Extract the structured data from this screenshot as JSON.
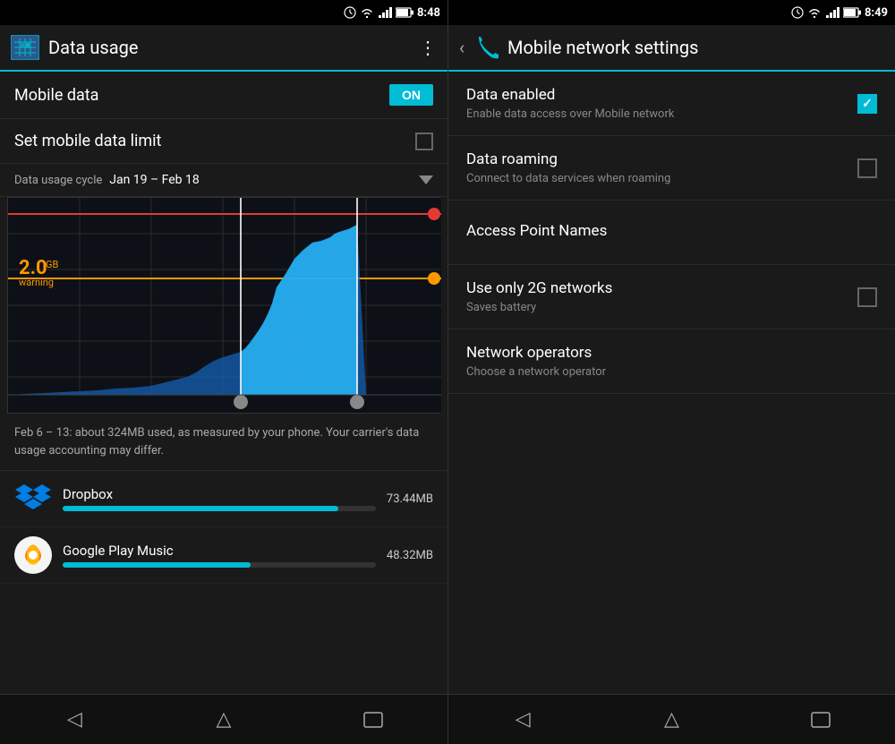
{
  "left": {
    "statusBar": {
      "time": "8:48",
      "icons": "clock wifi signal battery"
    },
    "toolbar": {
      "title": "Data usage",
      "iconName": "data-usage-icon"
    },
    "mobileData": {
      "label": "Mobile data",
      "toggleLabel": "ON"
    },
    "setLimit": {
      "label": "Set mobile data limit"
    },
    "cycle": {
      "label": "Data usage cycle",
      "value": "Jan 19 – Feb 18"
    },
    "chartInfo": "Feb 6 – 13: about 324MB used, as measured by your phone. Your carrier's data usage accounting may differ.",
    "warningLabel": "warning",
    "warningValue": "2.0",
    "warningUnit": "GB",
    "apps": [
      {
        "name": "Dropbox",
        "size": "73.44MB",
        "barPercent": 88,
        "iconType": "dropbox"
      },
      {
        "name": "Google Play Music",
        "size": "48.32MB",
        "barPercent": 60,
        "iconType": "gpm"
      }
    ],
    "nav": {
      "back": "◁",
      "home": "△",
      "recent": "▭"
    }
  },
  "right": {
    "statusBar": {
      "time": "8:49",
      "icons": "clock wifi signal battery"
    },
    "toolbar": {
      "title": "Mobile network settings"
    },
    "settings": [
      {
        "id": "data-enabled",
        "title": "Data enabled",
        "subtitle": "Enable data access over Mobile network",
        "hasCheckbox": true,
        "checked": true
      },
      {
        "id": "data-roaming",
        "title": "Data roaming",
        "subtitle": "Connect to data services when roaming",
        "hasCheckbox": true,
        "checked": false
      },
      {
        "id": "access-point-names",
        "title": "Access Point Names",
        "subtitle": "",
        "hasCheckbox": false,
        "checked": false
      },
      {
        "id": "use-only-2g",
        "title": "Use only 2G networks",
        "subtitle": "Saves battery",
        "hasCheckbox": true,
        "checked": false
      },
      {
        "id": "network-operators",
        "title": "Network operators",
        "subtitle": "Choose a network operator",
        "hasCheckbox": false,
        "checked": false
      }
    ],
    "nav": {
      "back": "◁",
      "home": "△",
      "recent": "▭"
    }
  }
}
